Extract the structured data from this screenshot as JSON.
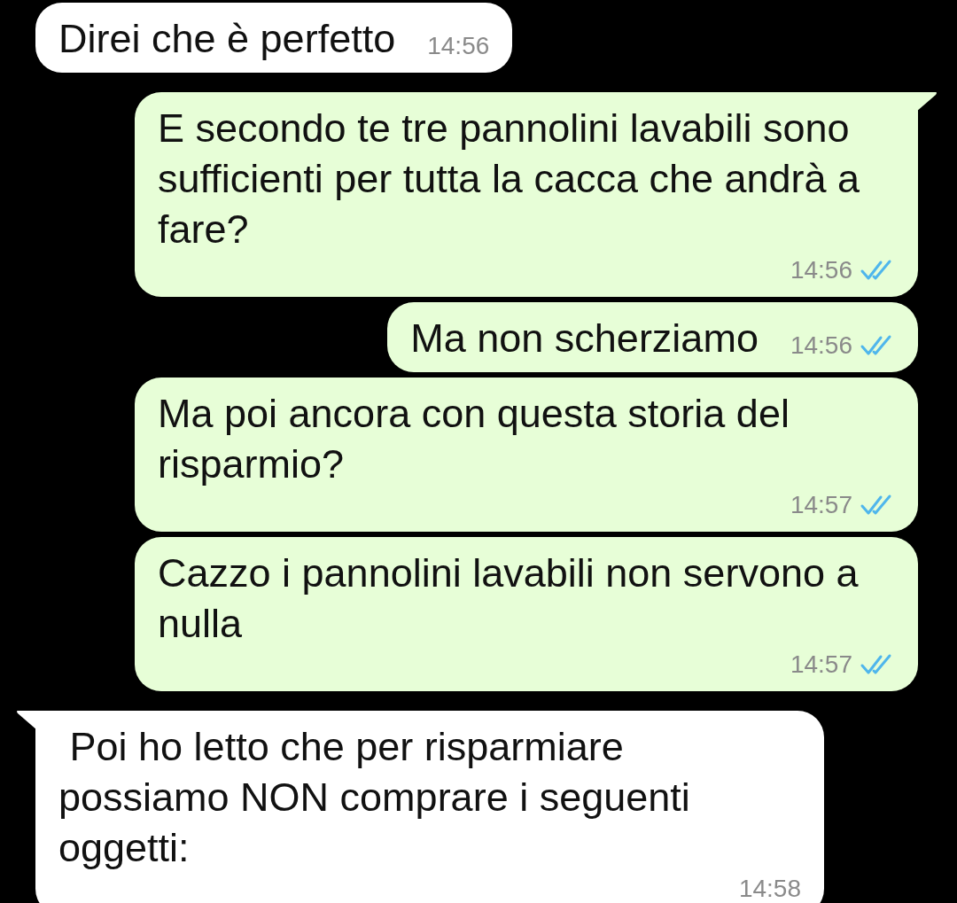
{
  "messages": [
    {
      "kind": "incoming",
      "tail": false,
      "text": "Direi che è perfetto",
      "time": "14:56"
    },
    {
      "kind": "outgoing",
      "tail": true,
      "text": "E secondo te tre pannolini lavabili sono sufficienti per tutta la cacca che andrà a fare?",
      "time": "14:56",
      "read": true
    },
    {
      "kind": "outgoing",
      "tail": false,
      "text": "Ma non scherziamo",
      "time": "14:56",
      "read": true
    },
    {
      "kind": "outgoing",
      "tail": false,
      "text": "Ma poi ancora con questa storia del risparmio?",
      "time": "14:57",
      "read": true
    },
    {
      "kind": "outgoing",
      "tail": false,
      "text": "Cazzo i pannolini lavabili non servono a nulla",
      "time": "14:57",
      "read": true
    },
    {
      "kind": "incoming",
      "tail": true,
      "text": " Poi ho letto che per risparmiare possiamo NON comprare i seguenti oggetti:",
      "time": "14:58"
    }
  ]
}
